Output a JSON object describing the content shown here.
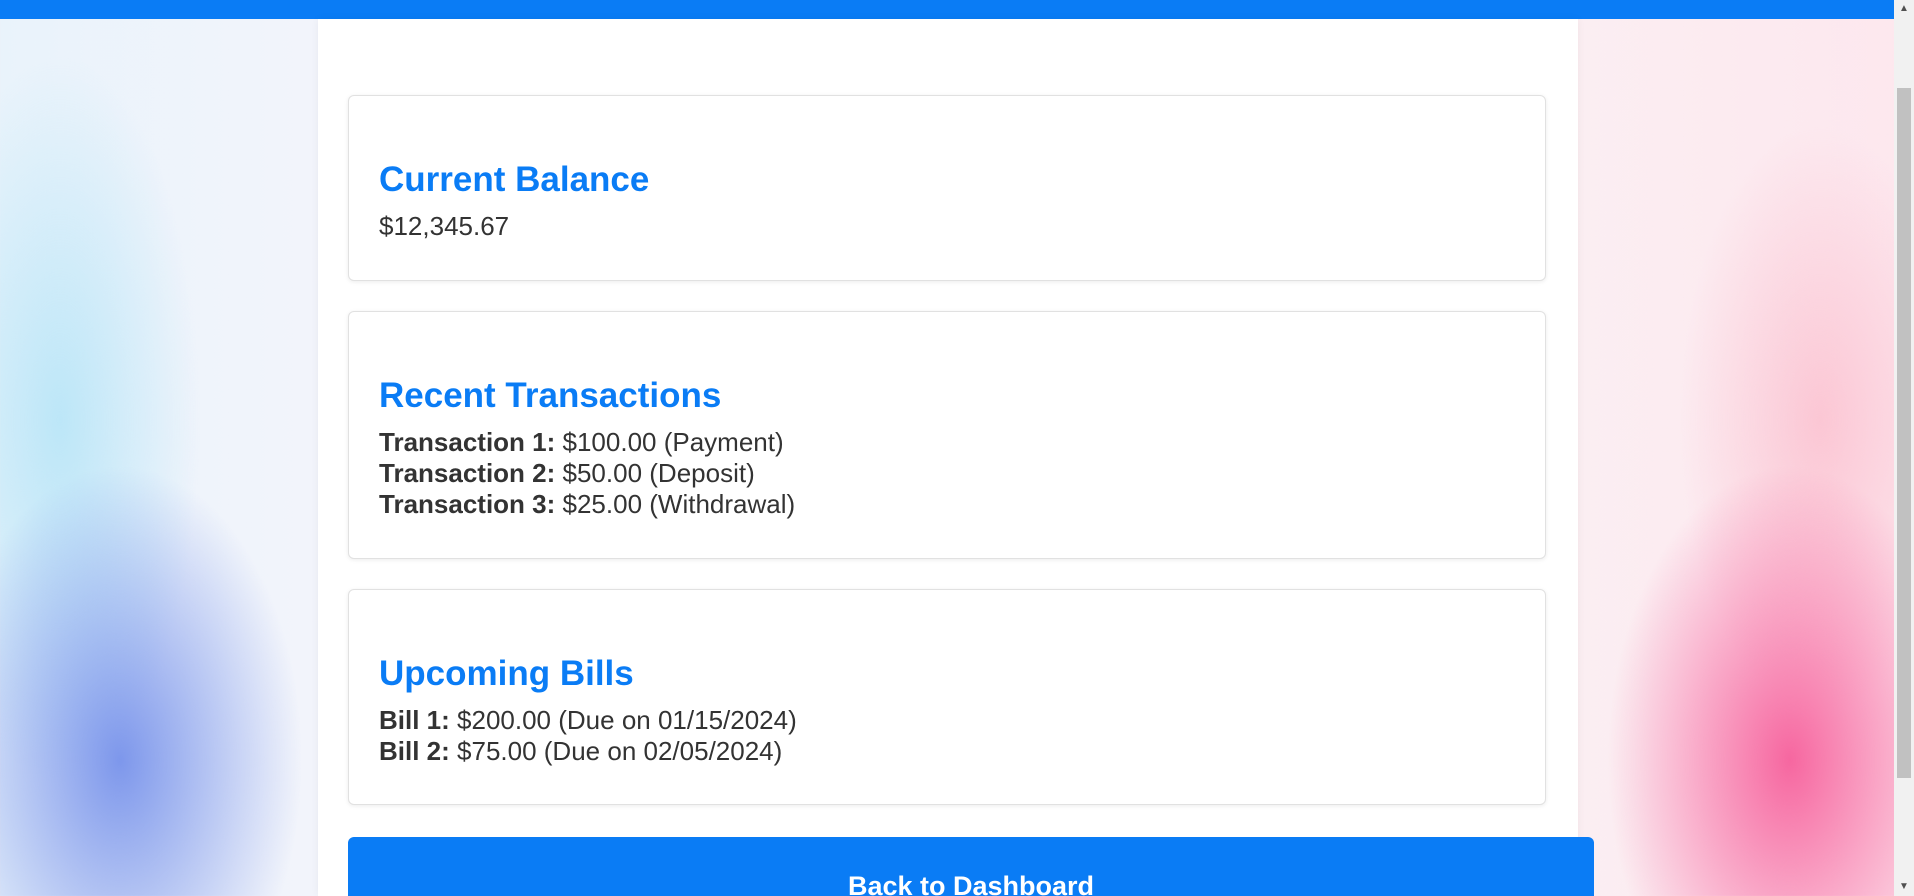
{
  "balance_card": {
    "title": "Current Balance",
    "amount": "$12,345.67"
  },
  "transactions_card": {
    "title": "Recent Transactions",
    "items": [
      {
        "label": "Transaction 1:",
        "value": "$100.00 (Payment)"
      },
      {
        "label": "Transaction 2:",
        "value": "$50.00 (Deposit)"
      },
      {
        "label": "Transaction 3:",
        "value": "$25.00 (Withdrawal)"
      }
    ]
  },
  "bills_card": {
    "title": "Upcoming Bills",
    "items": [
      {
        "label": "Bill 1:",
        "value": "$200.00 (Due on 01/15/2024)"
      },
      {
        "label": "Bill 2:",
        "value": "$75.00 (Due on 02/05/2024)"
      }
    ]
  },
  "back_button": {
    "label": "Back to Dashboard"
  },
  "scrollbar": {
    "up_icon": "▲",
    "down_icon": "▼"
  },
  "colors": {
    "accent": "#0a7cf5",
    "text": "#333333",
    "card_border": "#e1e1e1"
  }
}
